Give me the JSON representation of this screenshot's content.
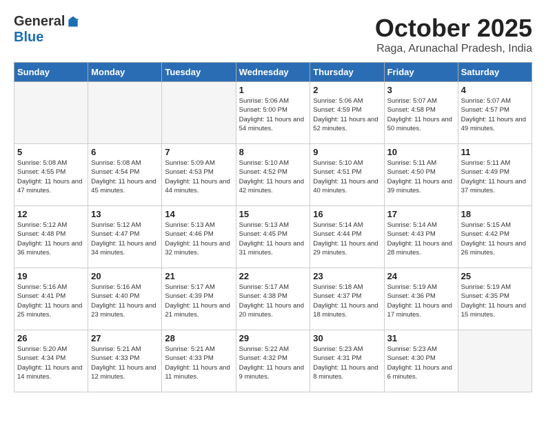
{
  "header": {
    "logo": {
      "general": "General",
      "blue": "Blue"
    },
    "title": "October 2025",
    "location": "Raga, Arunachal Pradesh, India"
  },
  "weekdays": [
    "Sunday",
    "Monday",
    "Tuesday",
    "Wednesday",
    "Thursday",
    "Friday",
    "Saturday"
  ],
  "weeks": [
    [
      {
        "day": "",
        "sunrise": "",
        "sunset": "",
        "daylight": ""
      },
      {
        "day": "",
        "sunrise": "",
        "sunset": "",
        "daylight": ""
      },
      {
        "day": "",
        "sunrise": "",
        "sunset": "",
        "daylight": ""
      },
      {
        "day": "1",
        "sunrise": "Sunrise: 5:06 AM",
        "sunset": "Sunset: 5:00 PM",
        "daylight": "Daylight: 11 hours and 54 minutes."
      },
      {
        "day": "2",
        "sunrise": "Sunrise: 5:06 AM",
        "sunset": "Sunset: 4:59 PM",
        "daylight": "Daylight: 11 hours and 52 minutes."
      },
      {
        "day": "3",
        "sunrise": "Sunrise: 5:07 AM",
        "sunset": "Sunset: 4:58 PM",
        "daylight": "Daylight: 11 hours and 50 minutes."
      },
      {
        "day": "4",
        "sunrise": "Sunrise: 5:07 AM",
        "sunset": "Sunset: 4:57 PM",
        "daylight": "Daylight: 11 hours and 49 minutes."
      }
    ],
    [
      {
        "day": "5",
        "sunrise": "Sunrise: 5:08 AM",
        "sunset": "Sunset: 4:55 PM",
        "daylight": "Daylight: 11 hours and 47 minutes."
      },
      {
        "day": "6",
        "sunrise": "Sunrise: 5:08 AM",
        "sunset": "Sunset: 4:54 PM",
        "daylight": "Daylight: 11 hours and 45 minutes."
      },
      {
        "day": "7",
        "sunrise": "Sunrise: 5:09 AM",
        "sunset": "Sunset: 4:53 PM",
        "daylight": "Daylight: 11 hours and 44 minutes."
      },
      {
        "day": "8",
        "sunrise": "Sunrise: 5:10 AM",
        "sunset": "Sunset: 4:52 PM",
        "daylight": "Daylight: 11 hours and 42 minutes."
      },
      {
        "day": "9",
        "sunrise": "Sunrise: 5:10 AM",
        "sunset": "Sunset: 4:51 PM",
        "daylight": "Daylight: 11 hours and 40 minutes."
      },
      {
        "day": "10",
        "sunrise": "Sunrise: 5:11 AM",
        "sunset": "Sunset: 4:50 PM",
        "daylight": "Daylight: 11 hours and 39 minutes."
      },
      {
        "day": "11",
        "sunrise": "Sunrise: 5:11 AM",
        "sunset": "Sunset: 4:49 PM",
        "daylight": "Daylight: 11 hours and 37 minutes."
      }
    ],
    [
      {
        "day": "12",
        "sunrise": "Sunrise: 5:12 AM",
        "sunset": "Sunset: 4:48 PM",
        "daylight": "Daylight: 11 hours and 36 minutes."
      },
      {
        "day": "13",
        "sunrise": "Sunrise: 5:12 AM",
        "sunset": "Sunset: 4:47 PM",
        "daylight": "Daylight: 11 hours and 34 minutes."
      },
      {
        "day": "14",
        "sunrise": "Sunrise: 5:13 AM",
        "sunset": "Sunset: 4:46 PM",
        "daylight": "Daylight: 11 hours and 32 minutes."
      },
      {
        "day": "15",
        "sunrise": "Sunrise: 5:13 AM",
        "sunset": "Sunset: 4:45 PM",
        "daylight": "Daylight: 11 hours and 31 minutes."
      },
      {
        "day": "16",
        "sunrise": "Sunrise: 5:14 AM",
        "sunset": "Sunset: 4:44 PM",
        "daylight": "Daylight: 11 hours and 29 minutes."
      },
      {
        "day": "17",
        "sunrise": "Sunrise: 5:14 AM",
        "sunset": "Sunset: 4:43 PM",
        "daylight": "Daylight: 11 hours and 28 minutes."
      },
      {
        "day": "18",
        "sunrise": "Sunrise: 5:15 AM",
        "sunset": "Sunset: 4:42 PM",
        "daylight": "Daylight: 11 hours and 26 minutes."
      }
    ],
    [
      {
        "day": "19",
        "sunrise": "Sunrise: 5:16 AM",
        "sunset": "Sunset: 4:41 PM",
        "daylight": "Daylight: 11 hours and 25 minutes."
      },
      {
        "day": "20",
        "sunrise": "Sunrise: 5:16 AM",
        "sunset": "Sunset: 4:40 PM",
        "daylight": "Daylight: 11 hours and 23 minutes."
      },
      {
        "day": "21",
        "sunrise": "Sunrise: 5:17 AM",
        "sunset": "Sunset: 4:39 PM",
        "daylight": "Daylight: 11 hours and 21 minutes."
      },
      {
        "day": "22",
        "sunrise": "Sunrise: 5:17 AM",
        "sunset": "Sunset: 4:38 PM",
        "daylight": "Daylight: 11 hours and 20 minutes."
      },
      {
        "day": "23",
        "sunrise": "Sunrise: 5:18 AM",
        "sunset": "Sunset: 4:37 PM",
        "daylight": "Daylight: 11 hours and 18 minutes."
      },
      {
        "day": "24",
        "sunrise": "Sunrise: 5:19 AM",
        "sunset": "Sunset: 4:36 PM",
        "daylight": "Daylight: 11 hours and 17 minutes."
      },
      {
        "day": "25",
        "sunrise": "Sunrise: 5:19 AM",
        "sunset": "Sunset: 4:35 PM",
        "daylight": "Daylight: 11 hours and 15 minutes."
      }
    ],
    [
      {
        "day": "26",
        "sunrise": "Sunrise: 5:20 AM",
        "sunset": "Sunset: 4:34 PM",
        "daylight": "Daylight: 11 hours and 14 minutes."
      },
      {
        "day": "27",
        "sunrise": "Sunrise: 5:21 AM",
        "sunset": "Sunset: 4:33 PM",
        "daylight": "Daylight: 11 hours and 12 minutes."
      },
      {
        "day": "28",
        "sunrise": "Sunrise: 5:21 AM",
        "sunset": "Sunset: 4:33 PM",
        "daylight": "Daylight: 11 hours and 11 minutes."
      },
      {
        "day": "29",
        "sunrise": "Sunrise: 5:22 AM",
        "sunset": "Sunset: 4:32 PM",
        "daylight": "Daylight: 11 hours and 9 minutes."
      },
      {
        "day": "30",
        "sunrise": "Sunrise: 5:23 AM",
        "sunset": "Sunset: 4:31 PM",
        "daylight": "Daylight: 11 hours and 8 minutes."
      },
      {
        "day": "31",
        "sunrise": "Sunrise: 5:23 AM",
        "sunset": "Sunset: 4:30 PM",
        "daylight": "Daylight: 11 hours and 6 minutes."
      },
      {
        "day": "",
        "sunrise": "",
        "sunset": "",
        "daylight": ""
      }
    ]
  ]
}
